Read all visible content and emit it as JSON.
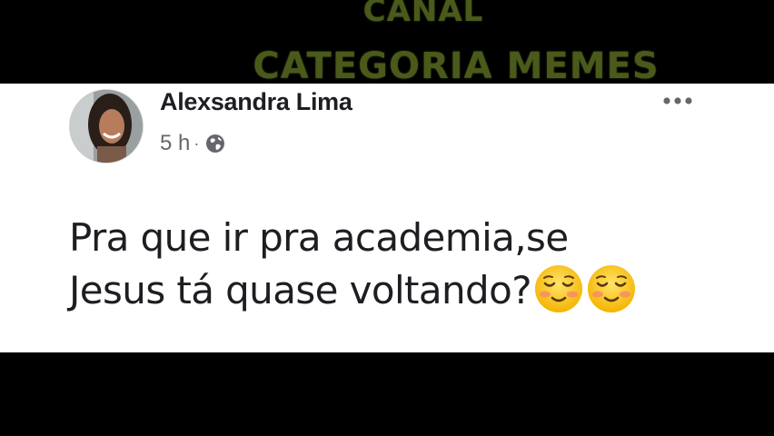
{
  "watermark": {
    "line1": "CANAL",
    "line2": "CATEGORIA MEMES"
  },
  "post": {
    "author_name": "Alexsandra Lima",
    "timestamp": "5 h",
    "separator": "·",
    "audience_icon": "globe-icon",
    "more_icon": "more-options-icon",
    "text_line1": "Pra que ir pra academia,se",
    "text_line2": "Jesus tá quase voltando?",
    "emojis": [
      "relieved-face-emoji",
      "relieved-face-emoji"
    ]
  },
  "colors": {
    "background": "#000000",
    "card": "#ffffff",
    "name": "#1c1e21",
    "meta": "#65676b",
    "watermark": "#4a5a1a"
  }
}
